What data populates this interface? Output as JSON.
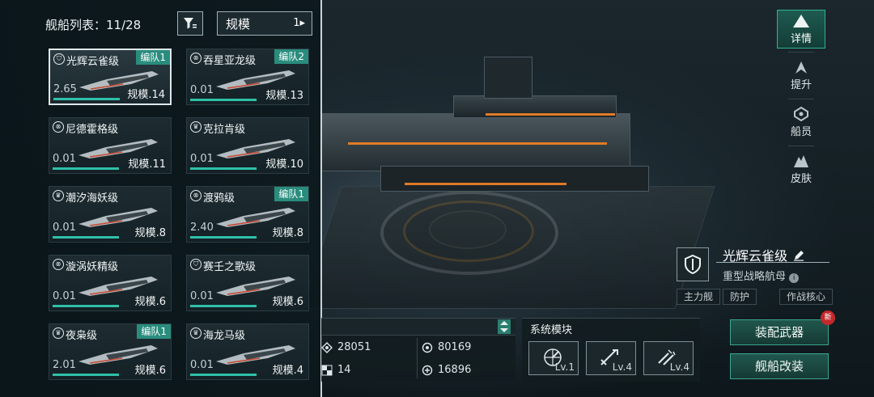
{
  "header": {
    "list_title": "舰船列表：11/28",
    "sort_value": "规模",
    "sort_icon": "1"
  },
  "cards": [
    {
      "name": "光辉云雀级",
      "tag": "编队1",
      "value": "2.65",
      "scale": "规模.14",
      "icon": "shield-icon",
      "selected": true
    },
    {
      "name": "吞星亚龙级",
      "tag": "编队2",
      "value": "0.01",
      "scale": "规模.13",
      "icon": "target-icon",
      "selected": false
    },
    {
      "name": "尼德霍格级",
      "tag": "",
      "value": "0.01",
      "scale": "规模.11",
      "icon": "target-icon",
      "selected": false
    },
    {
      "name": "克拉肯级",
      "tag": "",
      "value": "0.01",
      "scale": "规模.10",
      "icon": "crown-icon",
      "selected": false
    },
    {
      "name": "潮汐海妖级",
      "tag": "",
      "value": "0.01",
      "scale": "规模.8",
      "icon": "crown-icon",
      "selected": false
    },
    {
      "name": "渡鸦级",
      "tag": "编队1",
      "value": "2.40",
      "scale": "规模.8",
      "icon": "target-icon",
      "selected": false
    },
    {
      "name": "漩涡妖精级",
      "tag": "",
      "value": "0.01",
      "scale": "规模.6",
      "icon": "target-icon",
      "selected": false
    },
    {
      "name": "赛壬之歌级",
      "tag": "",
      "value": "0.01",
      "scale": "规模.6",
      "icon": "shield-icon",
      "selected": false
    },
    {
      "name": "夜枭级",
      "tag": "编队1",
      "value": "2.01",
      "scale": "规模.6",
      "icon": "crown-icon",
      "selected": false
    },
    {
      "name": "海龙马级",
      "tag": "",
      "value": "0.01",
      "scale": "规模.4",
      "icon": "crown-icon",
      "selected": false
    }
  ],
  "stats": {
    "hp": "28051",
    "attack": "80169",
    "slots": "14",
    "defense": "16896"
  },
  "modules": {
    "title": "系统模块",
    "items": [
      {
        "icon": "radar-icon",
        "level": "Lv.1"
      },
      {
        "icon": "missile-icon",
        "level": "Lv.4"
      },
      {
        "icon": "torpedo-icon",
        "level": "Lv.4"
      }
    ]
  },
  "ship": {
    "name": "光辉云雀级",
    "type": "重型战略航母",
    "chips": [
      "主力舰",
      "防护",
      "作战核心"
    ]
  },
  "actions": {
    "equip_label": "装配武器",
    "modify_label": "舰船改装",
    "new_badge": "新"
  },
  "nav": [
    {
      "label": "详情",
      "active": true
    },
    {
      "label": "提升",
      "active": false
    },
    {
      "label": "船员",
      "active": false
    },
    {
      "label": "皮肤",
      "active": false
    }
  ],
  "colors": {
    "accent": "#2ec0a8",
    "tag_bg": "#2a8c7d",
    "button_border": "#3ba58f"
  }
}
